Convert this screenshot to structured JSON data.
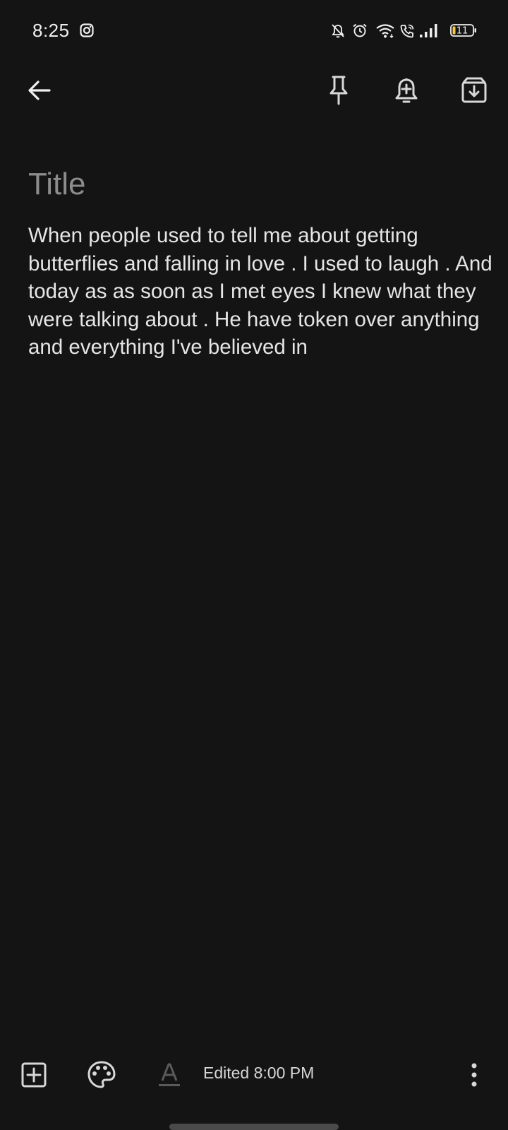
{
  "status_bar": {
    "time": "8:25",
    "battery_level": "11",
    "icons": [
      "instagram-icon",
      "notifications-off-icon",
      "alarm-icon",
      "wifi-icon",
      "wifi-calling-icon",
      "signal-icon",
      "battery-icon"
    ]
  },
  "toolbar": {
    "icons": [
      "back-arrow-icon",
      "pin-icon",
      "add-reminder-icon",
      "archive-icon"
    ]
  },
  "note": {
    "title_placeholder": "Title",
    "title_value": "",
    "body": "When people used to tell me about getting butterflies and falling in love . I used to laugh . And today as as soon as I met eyes I knew what they were talking about . He have token over anything and everything I've believed in"
  },
  "bottom_bar": {
    "edited_label": "Edited 8:00 PM",
    "icons": [
      "add-box-icon",
      "palette-icon",
      "text-format-icon",
      "more-vert-icon"
    ]
  },
  "colors": {
    "background": "#141414",
    "text": "#e6e6e6",
    "placeholder": "#8c8c8c",
    "battery_fill": "#f2c94c"
  }
}
